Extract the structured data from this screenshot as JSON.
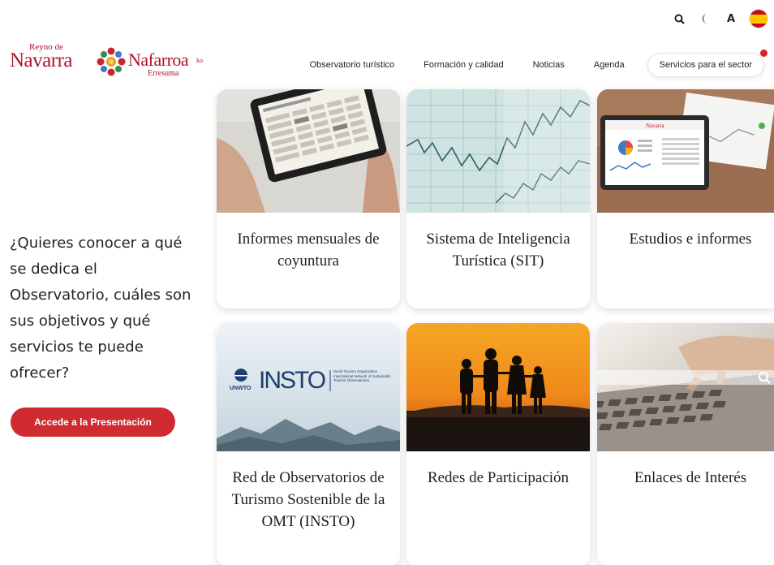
{
  "utility": {
    "search_icon": "search-icon",
    "dark_mode_icon": "moon-icon",
    "font_size_label": "A",
    "language_flag": "spain-flag-icon"
  },
  "logo": {
    "reyno_de": "Reyno de",
    "navarra": "Navarra",
    "nafarroa": "Nafarroa",
    "ko": "ko",
    "erresuma": "Erresuma"
  },
  "nav": {
    "items": [
      "Observatorio turístico",
      "Formación y calidad",
      "Noticias",
      "Agenda"
    ],
    "services_button": "Servicios para el sector"
  },
  "intro": {
    "text": "¿Quieres conocer a qué se dedica el Observatorio, cuáles son sus objetivos y qué servicios te puede ofrecer?",
    "cta": "Accede a la Presentación"
  },
  "cards": [
    {
      "title": "Informes mensuales de coyuntura"
    },
    {
      "title": "Sistema de Inteligencia Turística (SIT)"
    },
    {
      "title": "Estudios e informes"
    },
    {
      "title": "Red de Observatorios de Turismo Sostenible de la OMT (INSTO)"
    },
    {
      "title": "Redes de Participación"
    },
    {
      "title": "Enlaces de Interés"
    }
  ],
  "images": {
    "tablet_logo": "Navarra",
    "insto_brand": "UNWTO",
    "insto_name": "INSTO",
    "insto_caption": "World Tourism Organization International Network of Sustainable Tourism Observatories"
  },
  "colors": {
    "brand_red": "#b3122a",
    "cta_red": "#d12b32"
  }
}
